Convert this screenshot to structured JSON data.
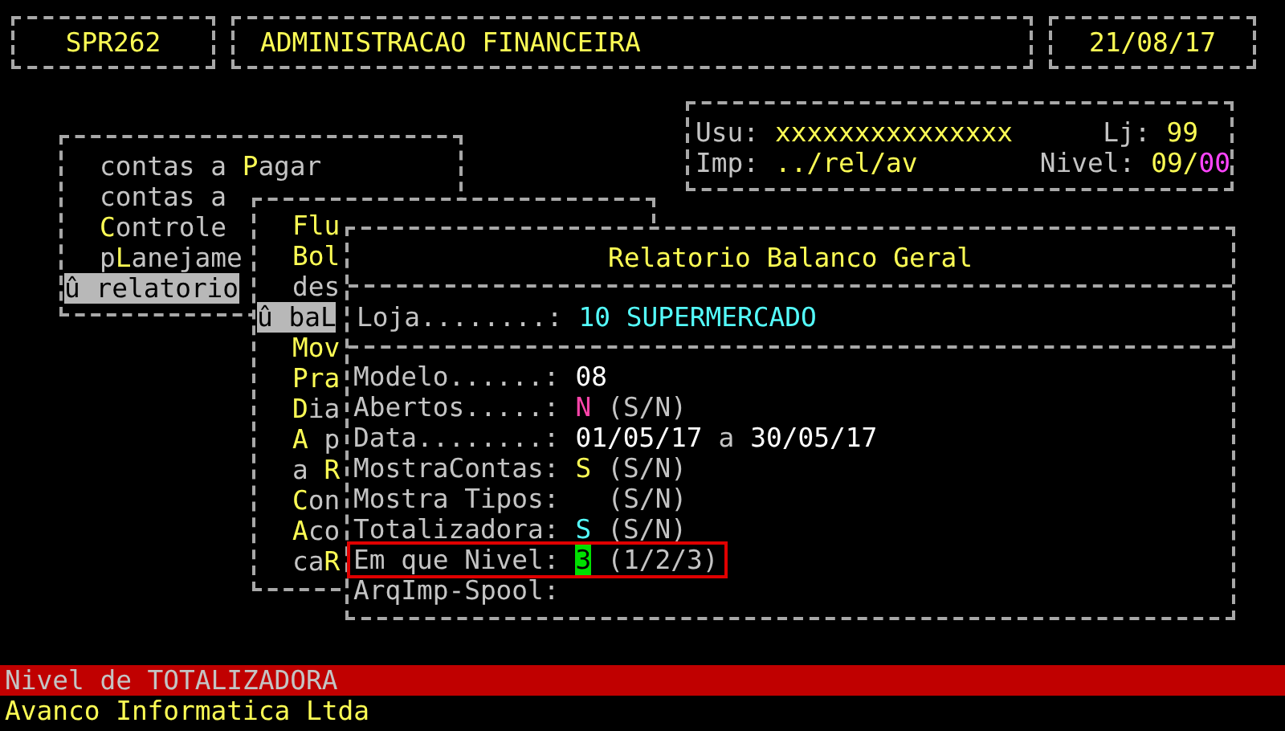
{
  "header": {
    "program": "SPR262",
    "title": "ADMINISTRACAO FINANCEIRA",
    "date": "21/08/17"
  },
  "session": {
    "user_label": "Usu:",
    "user": "xxxxxxxxxxxxxxx",
    "store_label": "Lj:",
    "store": "99",
    "printer_label": "Imp:",
    "printer": "../rel/av",
    "level_label": "Nivel:",
    "level_value": "09/",
    "level_extra": "00"
  },
  "menus": [
    {
      "items": [
        {
          "segments": [
            {
              "text": "contas a ",
              "hot": false
            },
            {
              "text": "P",
              "hot": true
            },
            {
              "text": "agar",
              "hot": false
            }
          ],
          "selected": false
        },
        {
          "segments": [
            {
              "text": "contas a",
              "hot": false
            }
          ],
          "selected": false
        },
        {
          "segments": [
            {
              "text": "C",
              "hot": true
            },
            {
              "text": "ontrole",
              "hot": false
            }
          ],
          "selected": false
        },
        {
          "segments": [
            {
              "text": "p",
              "hot": false
            },
            {
              "text": "L",
              "hot": true
            },
            {
              "text": "anejame",
              "hot": false
            }
          ],
          "selected": false
        },
        {
          "segments": [
            {
              "text": "û relatorio"
            }
          ],
          "selected": true
        }
      ]
    },
    {
      "items": [
        {
          "segments": [
            {
              "text": "Flu",
              "hot": true
            }
          ],
          "selected": false
        },
        {
          "segments": [
            {
              "text": "Bol",
              "hot": true
            }
          ],
          "selected": false
        },
        {
          "segments": [
            {
              "text": "des",
              "hot": false
            }
          ],
          "selected": false
        },
        {
          "segments": [
            {
              "text": "û baL"
            }
          ],
          "selected": true
        },
        {
          "segments": [
            {
              "text": "Mov",
              "hot": true
            }
          ],
          "selected": false
        },
        {
          "segments": [
            {
              "text": "Pra",
              "hot": true
            }
          ],
          "selected": false
        },
        {
          "segments": [
            {
              "text": "D",
              "hot": true
            },
            {
              "text": "ia",
              "hot": false
            }
          ],
          "selected": false
        },
        {
          "segments": [
            {
              "text": "A",
              "hot": true
            },
            {
              "text": " p",
              "hot": false
            }
          ],
          "selected": false
        },
        {
          "segments": [
            {
              "text": "a ",
              "hot": false
            },
            {
              "text": "R",
              "hot": true
            }
          ],
          "selected": false
        },
        {
          "segments": [
            {
              "text": "C",
              "hot": true
            },
            {
              "text": "on",
              "hot": false
            }
          ],
          "selected": false
        },
        {
          "segments": [
            {
              "text": "A",
              "hot": true
            },
            {
              "text": "co",
              "hot": false
            }
          ],
          "selected": false
        },
        {
          "segments": [
            {
              "text": "ca",
              "hot": false
            },
            {
              "text": "R",
              "hot": true
            }
          ],
          "selected": false
        }
      ]
    }
  ],
  "dialog": {
    "title": "Relatorio Balanco Geral",
    "store_label": "Loja........:",
    "store": "10 SUPERMERCADO",
    "fields": [
      {
        "label": "Modelo......:",
        "value": "08",
        "color": "#ffffff",
        "selected": false
      },
      {
        "label": "Abertos.....:",
        "value": "N",
        "color": "#ff44aa",
        "hint": "(S/N)",
        "selected": false
      },
      {
        "label": "Data........:",
        "value": "01/05/17",
        "joiner": "a",
        "value_to": "30/05/17",
        "color": "#ffffff",
        "selected": false
      },
      {
        "label": "MostraContas:",
        "value": "S",
        "color": "#fcfc54",
        "hint": "(S/N)",
        "selected": false
      },
      {
        "label": "Mostra Tipos:",
        "hint": "(S/N)",
        "selected": false
      },
      {
        "label": "Totalizadora:",
        "value": "S",
        "color": "#54fcfc",
        "hint": "(S/N)",
        "selected": false
      },
      {
        "label": "Em que Nivel:",
        "value": "3",
        "color": "#00e000",
        "hint": "(1/2/3)",
        "selected": true
      },
      {
        "label": "ArqImp-Spool:",
        "selected": false
      }
    ]
  },
  "status": {
    "message": "Nivel de TOTALIZADORA",
    "company": "Avanco Informatica Ltda"
  }
}
